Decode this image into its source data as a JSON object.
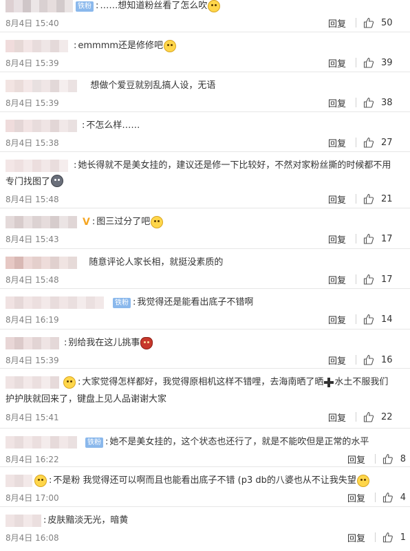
{
  "reply_label": "回复",
  "badge_label": "铁粉",
  "colors": {
    "badge": "#8ab8ec",
    "date": "#808080",
    "text": "#333333",
    "divider": "#e6e6e6"
  },
  "comments": [
    {
      "text": "……想知道粉丝看了怎么吹",
      "date": "8月4日 15:40",
      "likes": "50"
    },
    {
      "text": "emmmm还是修修吧",
      "date": "8月4日 15:39",
      "likes": "39"
    },
    {
      "text": "想做个爱豆就别乱搞人设，无语",
      "date": "8月4日 15:39",
      "likes": "38"
    },
    {
      "text": "不怎么样……",
      "date": "8月4日 15:38",
      "likes": "27"
    },
    {
      "text": "她长得就不是美女挂的，建议还是修一下比较好，不然对家粉丝撕的时候都不用",
      "text2": "专门找图了",
      "date": "8月4日 15:48",
      "likes": "21"
    },
    {
      "text": "图三过分了吧",
      "date": "8月4日 15:43",
      "likes": "17"
    },
    {
      "text": "随意评论人家长相，就挺没素质的",
      "date": "8月4日 15:48",
      "likes": "17"
    },
    {
      "text": "我觉得还是能看出底子不错啊",
      "date": "8月4日 16:19",
      "likes": "14"
    },
    {
      "text": "别给我在这儿挑事",
      "date": "8月4日 15:39",
      "likes": "16"
    },
    {
      "text": "大家觉得怎样都好，我觉得原相机这样不错哩，去海南晒了晒",
      "text_b": "水土不服我们",
      "text2": "护护肤就回来了，键盘上见人品谢谢大家",
      "date": "8月4日 15:41",
      "likes": "22"
    },
    {
      "text": "她不是美女挂的，这个状态也还行了，就是不能吹但是正常的水平",
      "date": "8月4日 16:22",
      "likes": "8"
    },
    {
      "text": "不是粉 我觉得还可以啊而且也能看出底子不错 (p3 db的八婆也从不让我失望",
      "date": "8月4日 17:00",
      "likes": "4"
    },
    {
      "text": "皮肤黯淡无光，暗黄",
      "date": "8月4日 16:08",
      "likes": "1"
    }
  ]
}
